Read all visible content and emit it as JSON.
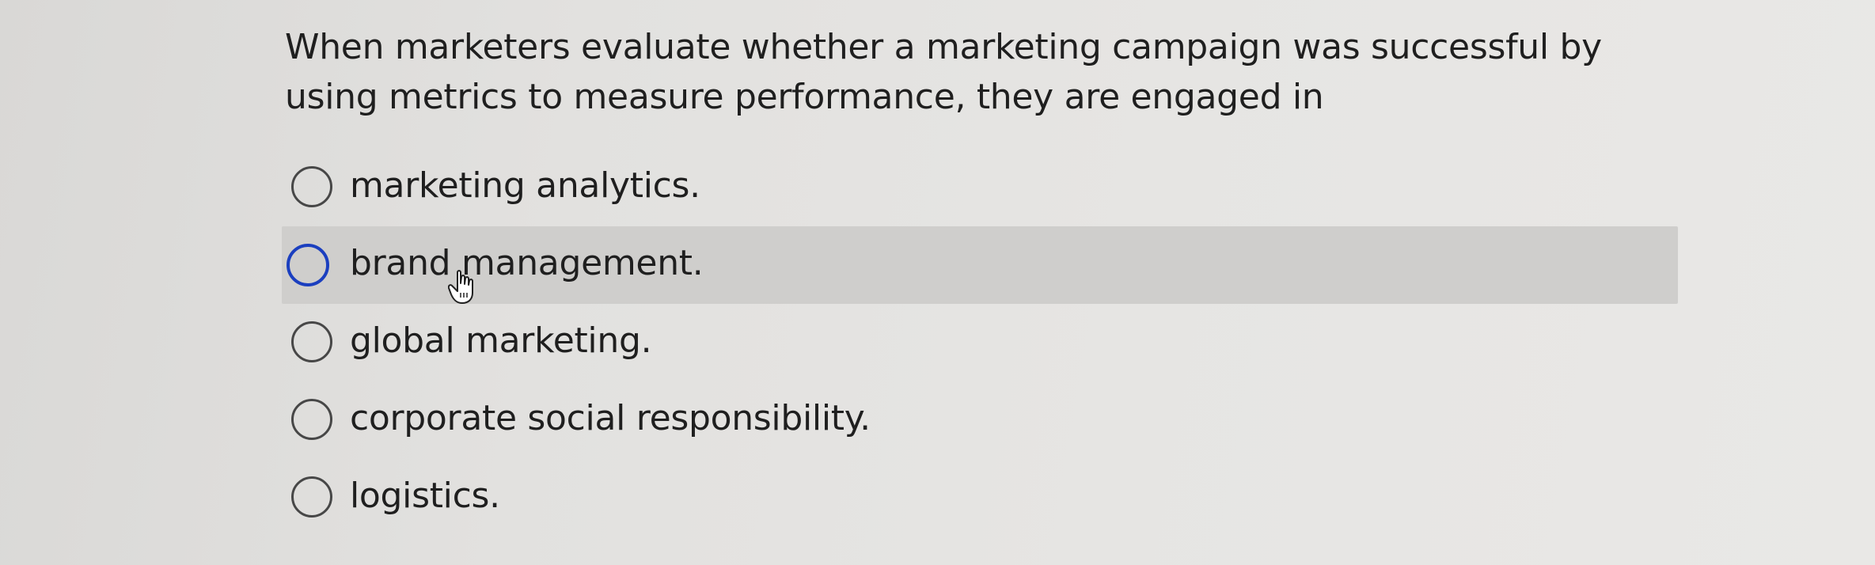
{
  "question": {
    "text": "When marketers evaluate whether a marketing campaign was successful by using metrics to measure performance, they are engaged in"
  },
  "options": [
    {
      "label": "marketing analytics.",
      "selected": false
    },
    {
      "label": "brand management.",
      "selected": false,
      "hovered": true
    },
    {
      "label": "global marketing.",
      "selected": false
    },
    {
      "label": "corporate social responsibility.",
      "selected": false
    },
    {
      "label": "logistics.",
      "selected": false
    }
  ],
  "colors": {
    "hover_background": "#cfcecc",
    "hover_radio_border": "#1b3fbf",
    "radio_border": "#474747",
    "text": "#1f1f1f"
  },
  "cursor": {
    "icon": "hand-pointer-icon"
  }
}
